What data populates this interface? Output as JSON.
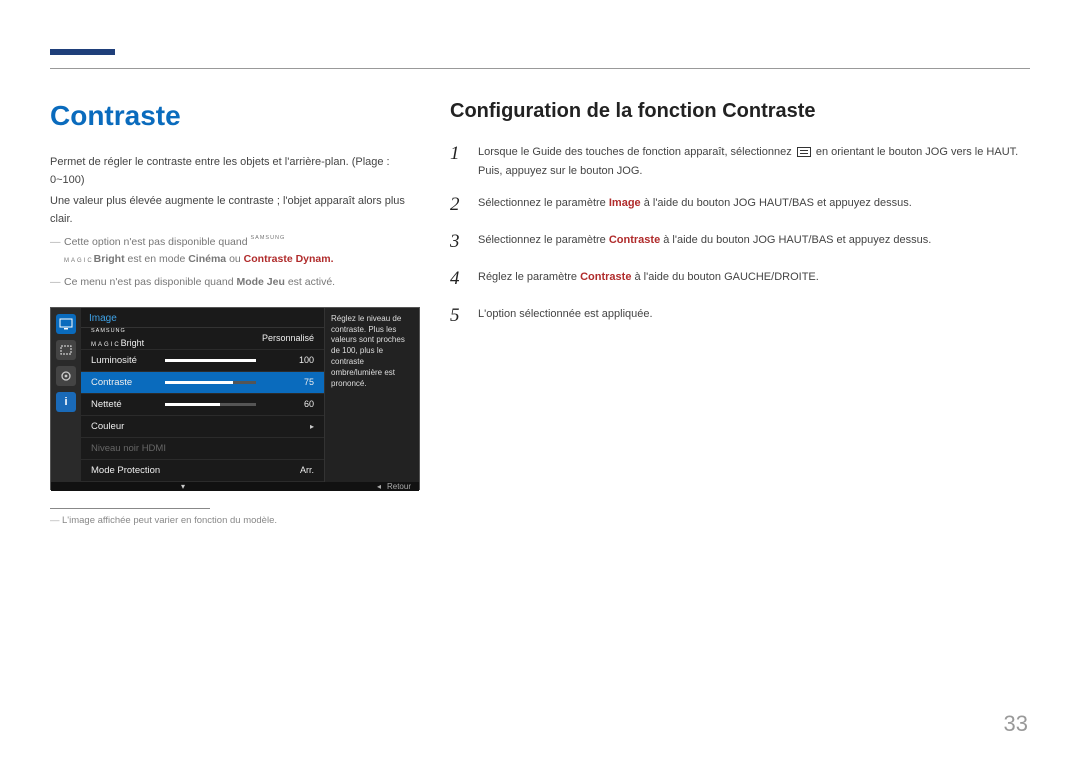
{
  "page_number": "33",
  "left": {
    "heading": "Contraste",
    "intro1": "Permet de régler le contraste entre les objets et l'arrière-plan. (Plage : 0~100)",
    "intro2": "Une valeur plus élevée augmente le contraste ; l'objet apparaît alors plus clair.",
    "note1_a": "Cette option n'est pas disponible quand ",
    "note1_magic_small": "SAMSUNG",
    "note1_magic_mid": "MAGIC",
    "note1_bright": "Bright",
    "note1_b": " est en mode ",
    "note1_cinema": "Cinéma",
    "note1_c": " ou ",
    "note1_dynam": "Contraste Dynam.",
    "note2_a": "Ce menu n'est pas disponible quand ",
    "note2_modejeu": "Mode Jeu",
    "note2_b": " est activé.",
    "footnote": "L'image affichée peut varier en fonction du modèle."
  },
  "osd": {
    "title": "Image",
    "desc": "Réglez le niveau de contraste. Plus les valeurs sont proches de 100, plus le contraste ombre/lumière est prononcé.",
    "footer_return": "Retour",
    "rows": {
      "bright_label_small": "SAMSUNG",
      "bright_label_mid": "MAGIC",
      "bright_label": "Bright",
      "bright_value": "Personnalisé",
      "luminosite_label": "Luminosité",
      "luminosite_value": "100",
      "contraste_label": "Contraste",
      "contraste_value": "75",
      "nettete_label": "Netteté",
      "nettete_value": "60",
      "couleur_label": "Couleur",
      "hdmi_label": "Niveau noir HDMI",
      "protection_label": "Mode Protection",
      "protection_value": "Arr."
    }
  },
  "right": {
    "heading": "Configuration de la fonction Contraste",
    "step1_num": "1",
    "step1_a": "Lorsque le Guide des touches de fonction apparaît, sélectionnez ",
    "step1_b": " en orientant le bouton JOG vers le HAUT. Puis, appuyez sur le bouton JOG.",
    "step2_num": "2",
    "step2_a": "Sélectionnez le paramètre ",
    "step2_hl": "Image",
    "step2_b": " à l'aide du bouton JOG HAUT/BAS et appuyez dessus.",
    "step3_num": "3",
    "step3_a": "Sélectionnez le paramètre ",
    "step3_hl": "Contraste",
    "step3_b": " à l'aide du bouton JOG HAUT/BAS et appuyez dessus.",
    "step4_num": "4",
    "step4_a": "Réglez le paramètre ",
    "step4_hl": "Contraste",
    "step4_b": " à l'aide du bouton GAUCHE/DROITE.",
    "step5_num": "5",
    "step5_text": "L'option sélectionnée est appliquée."
  }
}
